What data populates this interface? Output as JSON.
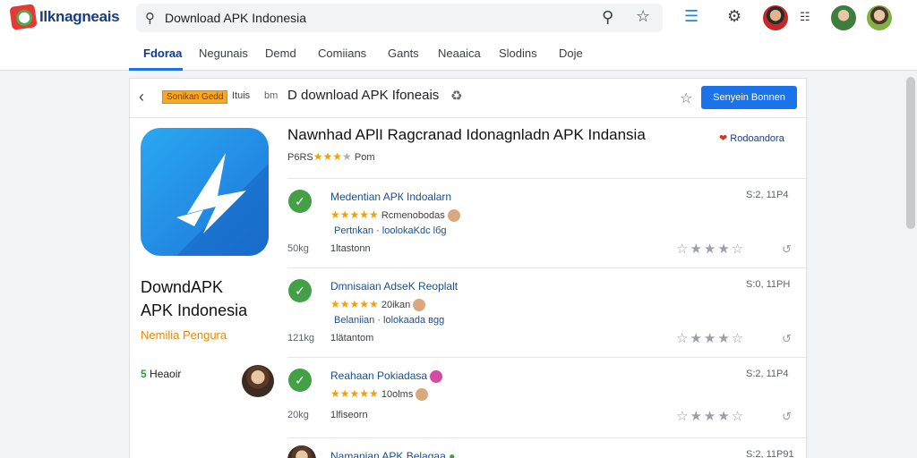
{
  "brand": {
    "name": "Ilknagneais"
  },
  "search": {
    "value": "Download APK Indonesia"
  },
  "nav": {
    "tabs": [
      "Fdoraa",
      "Negunais",
      "Demd",
      "Comiians",
      "Gants",
      "Neaaica",
      "Slodins",
      "Doje"
    ]
  },
  "breadcrumb": {
    "badge": "Sonikan Gedd",
    "middle": "Ituis",
    "sep": "bm",
    "title": "D download APK Ifoneais"
  },
  "card": {
    "cta_label": "Senyein Bonnen"
  },
  "app": {
    "name_line1": "DowndAPK",
    "name_line2": "APK Indonesia",
    "subtitle": "Nemilia Pengura",
    "headline": "Nawnhad APlI Ragcranad Idonagnladn APK Indansia",
    "rating_prefix": "P6RS",
    "rating_suffix": "Pom",
    "badge": "Rodoandora"
  },
  "sidebar": {
    "count": "5",
    "label": "Heaoir"
  },
  "reviews": [
    {
      "title": "Medentian APК Indoalarn",
      "stars_label": "Rcmenobodas",
      "meta": "Pertnkan · loolokaKdc lбg",
      "count": "50kg",
      "count_label": "1ltastonn",
      "time": "S:2, 11P4"
    },
    {
      "title": "Dmnisaian AdseK Reoplalt",
      "stars_label": "20ikan",
      "meta": "Belaniian · lolokaada вgg",
      "count": "121kg",
      "count_label": "1lätantom",
      "time": "S:0, 11PH"
    },
    {
      "title": "Reahaan Pokiadasa",
      "stars_label": "10olms",
      "meta": "",
      "count": "20kg",
      "count_label": "1lfiseorn",
      "time": "S:2, 11P4"
    },
    {
      "title": "Namanian APK Belagaa",
      "stars_label": "",
      "meta": "",
      "count": "",
      "count_label": "",
      "time": "S:2, 11P91"
    }
  ],
  "colors": {
    "accent": "#1a73e8",
    "star": "#f4a000",
    "brand_red": "#e53935",
    "green": "#43a047"
  }
}
